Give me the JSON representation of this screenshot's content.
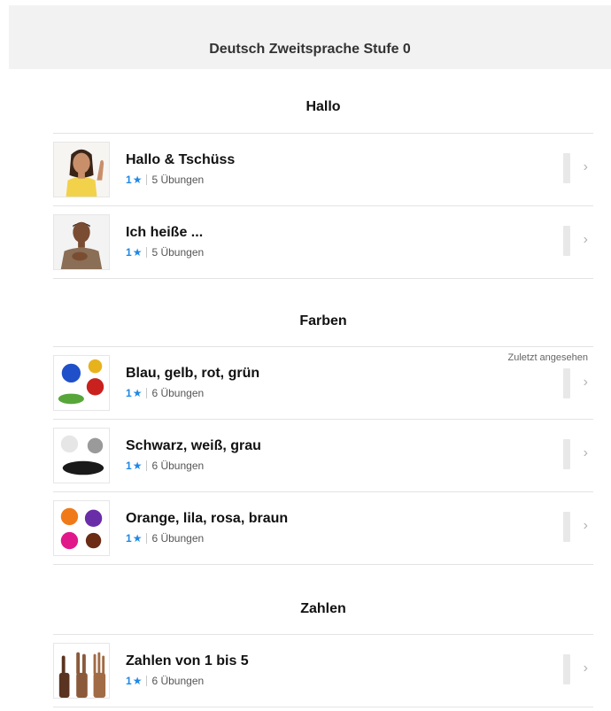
{
  "header": {
    "title": "Deutsch Zweitsprache Stufe 0"
  },
  "sections": [
    {
      "title": "Hallo",
      "items": [
        {
          "title": "Hallo & Tschüss",
          "count": "1",
          "exercises": "5 Übungen",
          "thumb": "girl-waving-image"
        },
        {
          "title": "Ich heiße ...",
          "count": "1",
          "exercises": "5 Übungen",
          "thumb": "boy-hand-on-chest-image"
        }
      ]
    },
    {
      "title": "Farben",
      "items": [
        {
          "title": "Blau, gelb, rot, grün",
          "count": "1",
          "exercises": "6 Übungen",
          "thumb": "color-powder-image",
          "recent_label": "Zuletzt angesehen"
        },
        {
          "title": "Schwarz, weiß, grau",
          "count": "1",
          "exercises": "6 Übungen",
          "thumb": "bw-powder-image"
        },
        {
          "title": "Orange, lila, rosa, braun",
          "count": "1",
          "exercises": "6 Übungen",
          "thumb": "color-powder-image"
        }
      ]
    },
    {
      "title": "Zahlen",
      "items": [
        {
          "title": "Zahlen von 1 bis 5",
          "count": "1",
          "exercises": "6 Übungen",
          "thumb": "counting-hands-image"
        }
      ]
    }
  ],
  "icons": {
    "pin": "pin-icon",
    "chevron": "chevron-right-icon"
  },
  "colors": {
    "accent": "#1e88e5",
    "header_bg": "#f2f2f2",
    "divider": "#e3e3e3"
  }
}
